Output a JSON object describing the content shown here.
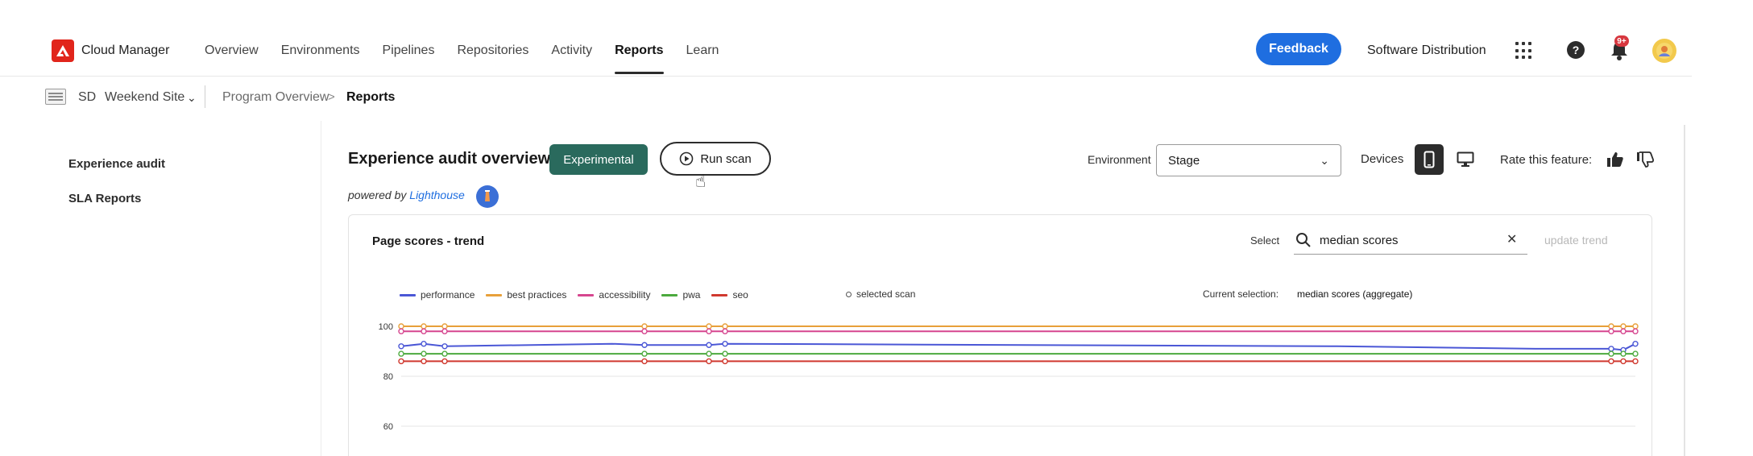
{
  "header": {
    "app_title": "Cloud Manager",
    "nav": [
      {
        "label": "Overview",
        "active": false
      },
      {
        "label": "Environments",
        "active": false
      },
      {
        "label": "Pipelines",
        "active": false
      },
      {
        "label": "Repositories",
        "active": false
      },
      {
        "label": "Activity",
        "active": false
      },
      {
        "label": "Reports",
        "active": true
      },
      {
        "label": "Learn",
        "active": false
      }
    ],
    "feedback_label": "Feedback",
    "software_distribution": "Software Distribution",
    "notification_count": "9+",
    "accent_color": "#1f6ee0",
    "brand_color": "#e1251b"
  },
  "breadcrumb": {
    "program_code": "SD",
    "program_name": "Weekend Site",
    "items": [
      "Program Overview",
      "Reports"
    ]
  },
  "sidebar": {
    "items": [
      "Experience audit",
      "SLA Reports"
    ]
  },
  "main": {
    "title": "Experience audit overview",
    "badge": "Experimental",
    "run_scan_label": "Run scan",
    "powered_by": "powered by",
    "powered_by_link": "Lighthouse",
    "environment_label": "Environment",
    "environment_value": "Stage",
    "devices_label": "Devices",
    "rate_label": "Rate this feature:"
  },
  "card": {
    "title": "Page scores - trend",
    "select_label": "Select",
    "search_value": "median scores",
    "update_label": "update trend",
    "legend": [
      {
        "name": "performance",
        "color": "#4b57d6"
      },
      {
        "name": "best practices",
        "color": "#e8a03a"
      },
      {
        "name": "accessibility",
        "color": "#d6468f"
      },
      {
        "name": "pwa",
        "color": "#4caa3e"
      },
      {
        "name": "seo",
        "color": "#d0392f"
      }
    ],
    "selected_scan_label": "selected scan",
    "current_selection_label": "Current selection:",
    "current_selection_value": "median scores (aggregate)"
  },
  "chart_data": {
    "type": "line",
    "title": "Page scores - trend",
    "ylim": [
      60,
      100
    ],
    "yticks": [
      "100",
      "80",
      "60"
    ],
    "grid": true,
    "legend_position": "top-left",
    "series": [
      {
        "name": "performance",
        "color": "#4b57d6",
        "values": [
          92,
          93,
          92,
          93,
          92.5,
          92.5,
          93,
          92,
          91,
          91,
          90.5,
          93
        ]
      },
      {
        "name": "best practices",
        "color": "#e8a03a",
        "values": [
          100,
          100,
          100,
          100,
          100,
          100,
          100,
          100,
          100,
          100,
          100,
          100
        ]
      },
      {
        "name": "accessibility",
        "color": "#d6468f",
        "values": [
          98,
          98,
          98,
          98,
          98,
          98,
          98,
          98,
          98,
          98,
          98,
          98
        ]
      },
      {
        "name": "pwa",
        "color": "#4caa3e",
        "values": [
          89,
          89,
          89,
          89,
          89,
          89,
          89,
          89,
          89,
          89,
          89,
          89
        ]
      },
      {
        "name": "seo",
        "color": "#d0392f",
        "values": [
          86,
          86,
          86,
          86,
          86,
          86,
          86,
          86,
          86,
          86,
          86,
          86
        ]
      }
    ]
  }
}
